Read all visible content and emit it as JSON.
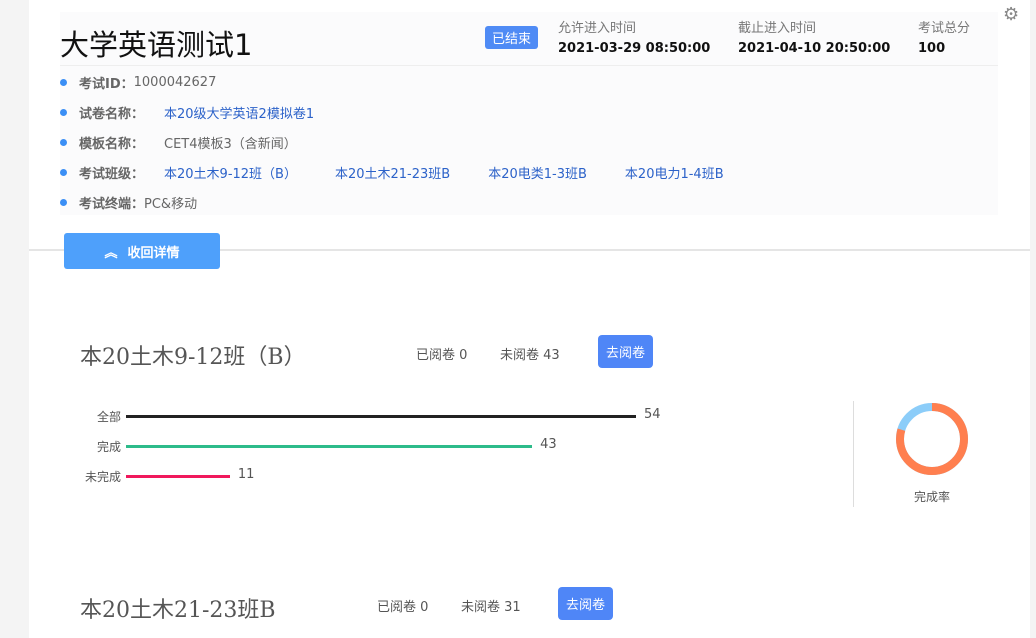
{
  "exam": {
    "title": "大学英语测试1",
    "status": "已结束",
    "meta": [
      {
        "label": "允许进入时间",
        "value": "2021-03-29 08:50:00"
      },
      {
        "label": "截止进入时间",
        "value": "2021-04-10 20:50:00"
      },
      {
        "label": "考试总分",
        "value": "100"
      }
    ],
    "id_label": "考试ID：",
    "id": "1000042627",
    "paper_label": "试卷名称：",
    "paper": "本20级大学英语2模拟卷1",
    "template_label": "模板名称：",
    "template": "CET4模板3（含新闻）",
    "classes_label": "考试班级：",
    "classes": [
      "本20土木9-12班（B）",
      "本20土木21-23班B",
      "本20电类1-3班B",
      "本20电力1-4班B"
    ],
    "terminal_label": "考试终端：",
    "terminal": "PC&移动"
  },
  "collapse_label": "收回详情",
  "sections": [
    {
      "title": "本20土木9-12班（B）",
      "read": "已阅卷 0",
      "unread": "未阅卷 43",
      "button": "去阅卷",
      "bars": [
        {
          "label": "全部",
          "value": 54,
          "color": "#222222"
        },
        {
          "label": "完成",
          "value": 43,
          "color": "#2dbb8a"
        },
        {
          "label": "未完成",
          "value": 11,
          "color": "#f0185c"
        }
      ],
      "donut_label": "完成率",
      "completion": 0.796
    },
    {
      "title": "本20土木21-23班B",
      "read": "已阅卷 0",
      "unread": "未阅卷 31",
      "button": "去阅卷"
    }
  ]
}
